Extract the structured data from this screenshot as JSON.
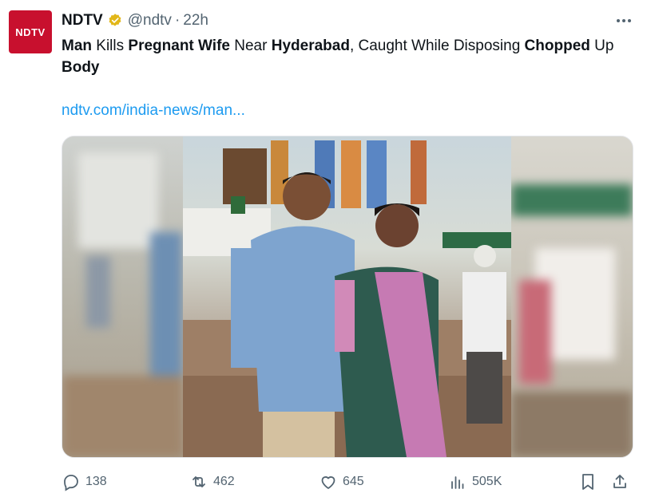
{
  "author": {
    "avatar_text": "NDTV",
    "name": "NDTV",
    "handle": "@ndtv",
    "separator": "·",
    "time": "22h",
    "verified_icon": "gold-checkmark-badge"
  },
  "tweet": {
    "segments": [
      {
        "text": "Man",
        "bold": true
      },
      {
        "text": " Kills ",
        "bold": false
      },
      {
        "text": "Pregnant Wife",
        "bold": true
      },
      {
        "text": " Near ",
        "bold": false
      },
      {
        "text": "Hyderabad",
        "bold": true
      },
      {
        "text": ", Caught While Disposing ",
        "bold": false
      },
      {
        "text": "Chopped",
        "bold": true
      },
      {
        "text": " Up ",
        "bold": false
      },
      {
        "text": "Body",
        "bold": true
      }
    ],
    "link": "ndtv.com/india-news/man..."
  },
  "media": {
    "description_icon": "photo-couple-in-church"
  },
  "actions": {
    "replies": "138",
    "reposts": "462",
    "likes": "645",
    "views": "505K"
  },
  "colors": {
    "brand_red": "#c8102e",
    "link_blue": "#1d9bf0",
    "muted": "#536471",
    "verified_gold": "#e2b719"
  }
}
